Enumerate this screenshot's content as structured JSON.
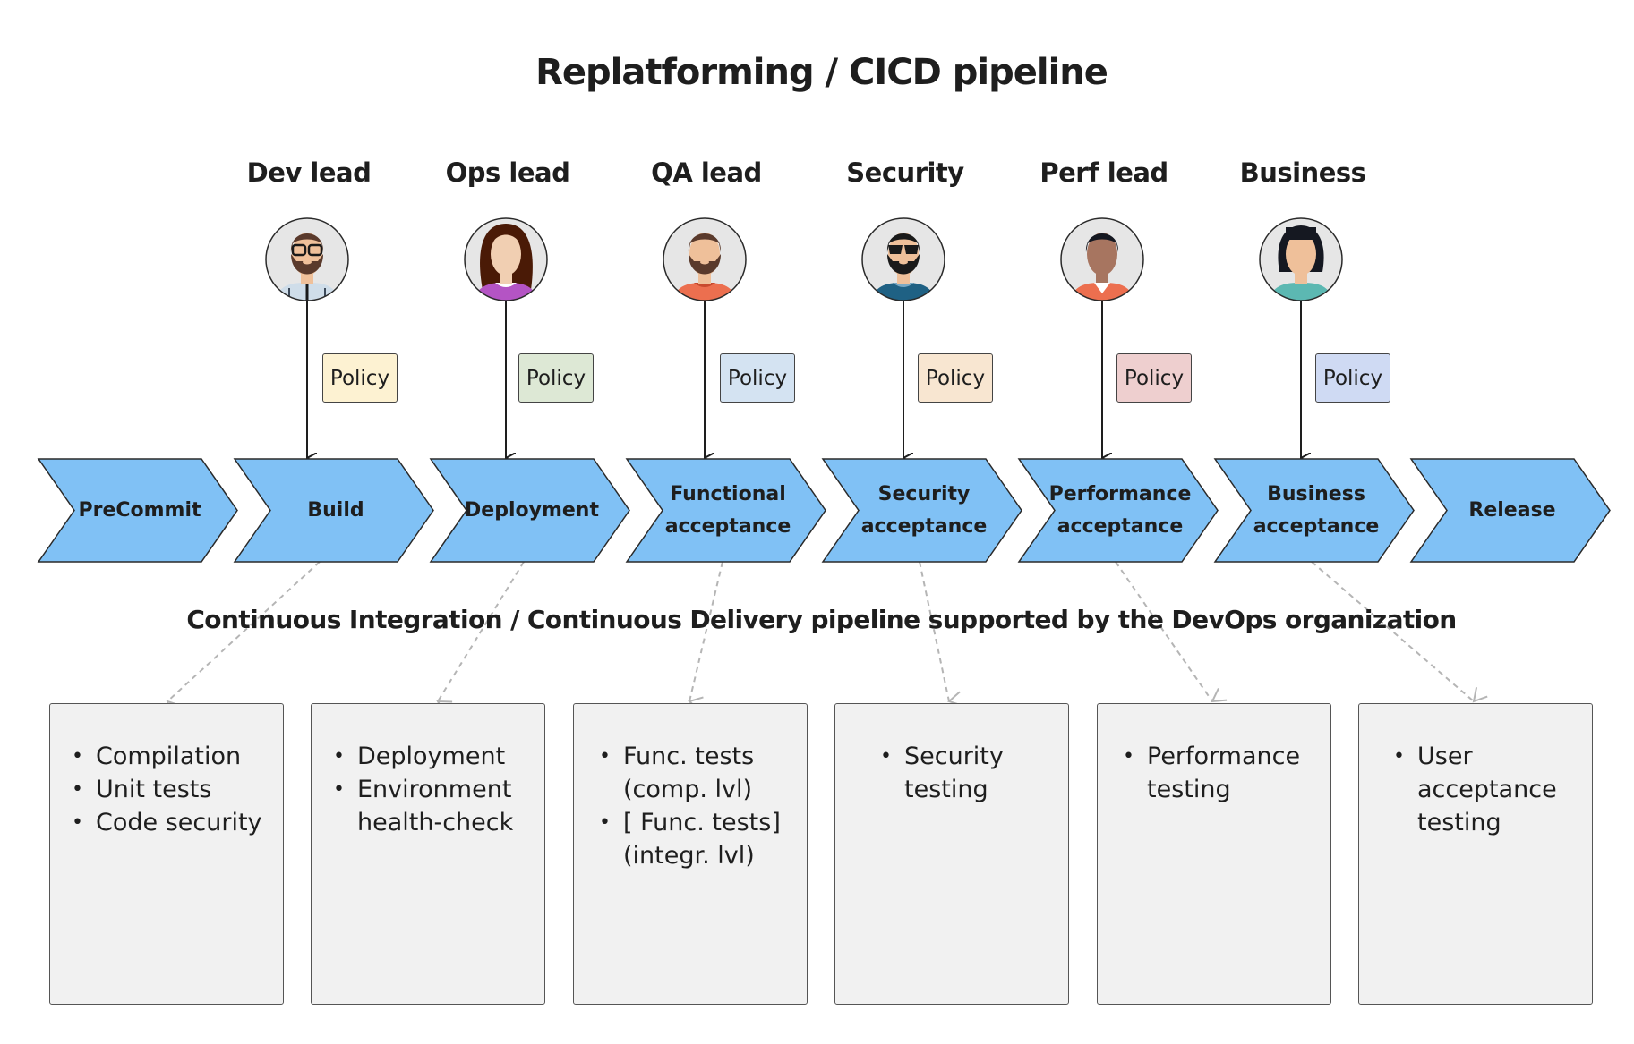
{
  "title": "Replatforming / CICD pipeline",
  "subtitle": "Continuous Integration / Continuous Delivery pipeline supported by the DevOps organization",
  "roles": [
    {
      "label": "Dev lead",
      "avatar": "bearded-man-glasses-avatar",
      "policy": "Policy",
      "policy_color": "#fdf2d2"
    },
    {
      "label": "Ops lead",
      "avatar": "long-haired-woman-avatar",
      "policy": "Policy",
      "policy_color": "#dde8d5"
    },
    {
      "label": "QA lead",
      "avatar": "bearded-man-avatar",
      "policy": "Policy",
      "policy_color": "#d4e3f2"
    },
    {
      "label": "Security",
      "avatar": "bearded-man-sunglasses-avatar",
      "policy": "Policy",
      "policy_color": "#f8e6d1"
    },
    {
      "label": "Perf lead",
      "avatar": "man-short-hair-avatar",
      "policy": "Policy",
      "policy_color": "#eecfcf"
    },
    {
      "label": "Business",
      "avatar": "woman-bob-hair-avatar",
      "policy": "Policy",
      "policy_color": "#cfdaf3"
    }
  ],
  "stages": [
    {
      "label": "PreCommit"
    },
    {
      "label": "Build"
    },
    {
      "label": "Deployment"
    },
    {
      "label": "Functional\nacceptance"
    },
    {
      "label": "Security\nacceptance"
    },
    {
      "label": "Performance\nacceptance"
    },
    {
      "label": "Business\nacceptance"
    },
    {
      "label": "Release"
    }
  ],
  "task_boxes": [
    {
      "items": [
        "Compilation",
        "Unit tests",
        "Code security"
      ]
    },
    {
      "items": [
        "Deployment",
        "Environment\nhealth-check"
      ]
    },
    {
      "items": [
        "Func. tests\n(comp. lvl)",
        "[ Func. tests]\n(integr. lvl)"
      ]
    },
    {
      "items": [
        "Security\ntesting"
      ]
    },
    {
      "items": [
        "Performance\ntesting"
      ]
    },
    {
      "items": [
        "User\nacceptance\ntesting"
      ]
    }
  ],
  "colors": {
    "stage_fill": "#80c1f5",
    "stage_stroke": "#2a2a2a",
    "box_fill": "#f1f1f1",
    "dashed_connector": "#b5b5b5",
    "avatar_bg": "#e6e6e6"
  }
}
